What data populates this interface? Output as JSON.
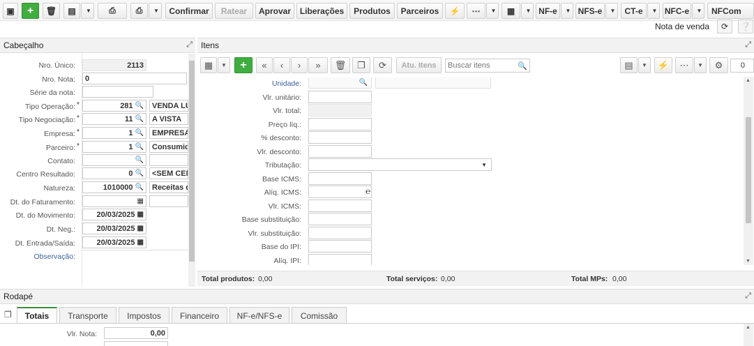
{
  "toolbar": {
    "confirmar": "Confirmar",
    "ratear": "Ratear",
    "aprovar": "Aprovar",
    "liberacoes": "Liberações",
    "produtos": "Produtos",
    "parceiros": "Parceiros",
    "nfe": "NF-e",
    "nfse": "NFS-e",
    "cte": "CT-e",
    "nfce": "NFC-e",
    "nfcom": "NFCom"
  },
  "subheader": {
    "title": "Nota de venda"
  },
  "cabecalho": {
    "title": "Cabeçalho",
    "nro_unico_label": "Nro. Único:",
    "nro_unico": "2113",
    "nro_nota_label": "Nro. Nota:",
    "nro_nota": "0",
    "serie_label": "Série da nota:",
    "tipo_operacao_label": "Tipo Operação:",
    "tipo_operacao": "281",
    "tipo_operacao_desc": "VENDA LU",
    "tipo_negociacao_label": "Tipo Negociação:",
    "tipo_negociacao": "11",
    "tipo_negociacao_desc": "A VISTA",
    "empresa_label": "Empresa:",
    "empresa": "1",
    "empresa_desc": "EMPRESA",
    "parceiro_label": "Parceiro:",
    "parceiro": "1",
    "parceiro_desc": "Consumid",
    "contato_label": "Contato:",
    "centro_label": "Centro Resultado:",
    "centro": "0",
    "centro_desc": "<SEM CEN",
    "natureza_label": "Natureza:",
    "natureza": "1010000",
    "natureza_desc": "Receitas d",
    "dt_fat_label": "Dt. do Faturamento:",
    "dt_mov_label": "Dt. do Movimento:",
    "dt_mov": "20/03/2025",
    "dt_neg_label": "Dt. Neg.:",
    "dt_neg": "20/03/2025",
    "dt_es_label": "Dt. Entrada/Saída:",
    "dt_es": "20/03/2025",
    "obs_label": "Observação:"
  },
  "itens": {
    "title": "Itens",
    "atu_itens": "Atu. Itens",
    "search_placeholder": "Buscar itens",
    "counter": "0",
    "unidade_label": "Unidade:",
    "fields": [
      "Vlr. unitário:",
      "Vlr. total:",
      "Preço líq.:",
      "% desconto:",
      "Vlr. desconto:",
      "Tributação:",
      "Base ICMS:",
      "Alíq. ICMS:",
      "Vlr. ICMS:",
      "Base substituição:",
      "Vlr. substituição:",
      "Base do IPI:",
      "Alíq. IPI:"
    ],
    "totals": {
      "produtos_label": "Total produtos:",
      "produtos": "0,00",
      "servicos_label": "Total serviços:",
      "servicos": "0,00",
      "mps_label": "Total MPs:",
      "mps": "0,00"
    }
  },
  "rodape": {
    "title": "Rodapé",
    "tabs": [
      "Totais",
      "Transporte",
      "Impostos",
      "Financeiro",
      "NF-e/NFS-e",
      "Comissão"
    ],
    "vlr_nota_label": "Vlr. Nota:",
    "vlr_nota": "0,00"
  }
}
